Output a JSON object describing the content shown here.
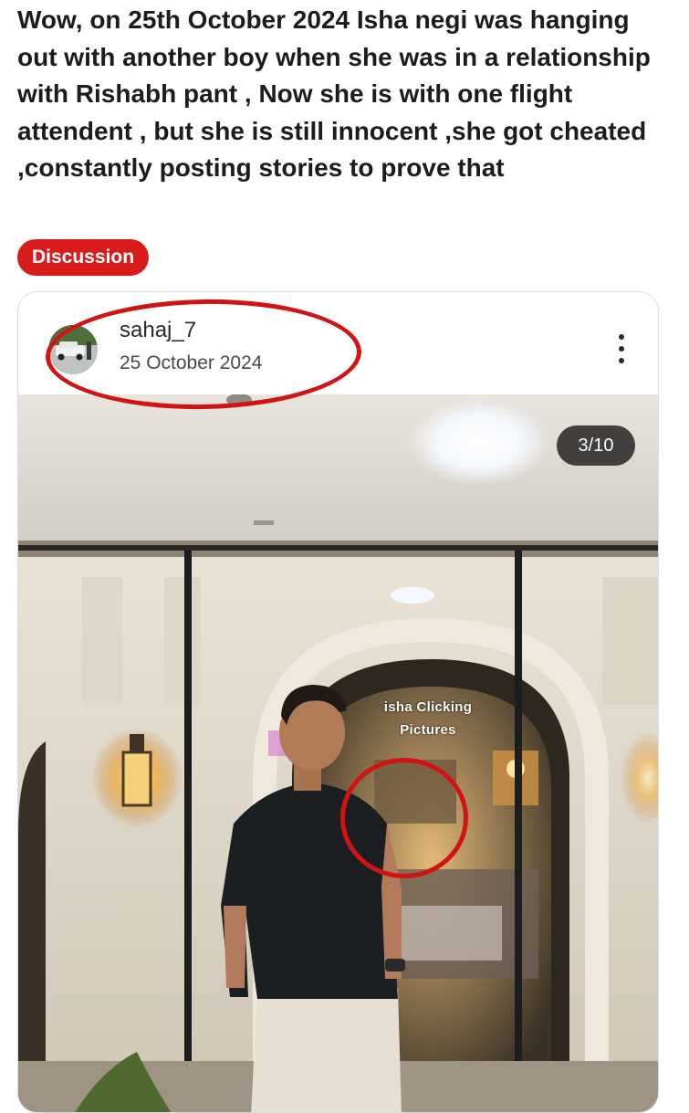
{
  "post": {
    "title": "Wow, on 25th October 2024 Isha negi was hanging out with another boy when she was in a relationship with Rishabh pant , Now she is with one flight attendent , but she is still innocent ,she got cheated ,constantly posting stories to prove that",
    "flair": "Discussion",
    "flair_color": "#d81c1c"
  },
  "embed": {
    "username": "sahaj_7",
    "date": "25 October 2024",
    "avatar_icon": "car-photo-avatar",
    "menu_icon": "more-vertical-icon",
    "image_counter": "3/10",
    "caption_line1": "isha Clicking",
    "caption_line2": "Pictures",
    "annotation_color": "#d21313"
  }
}
